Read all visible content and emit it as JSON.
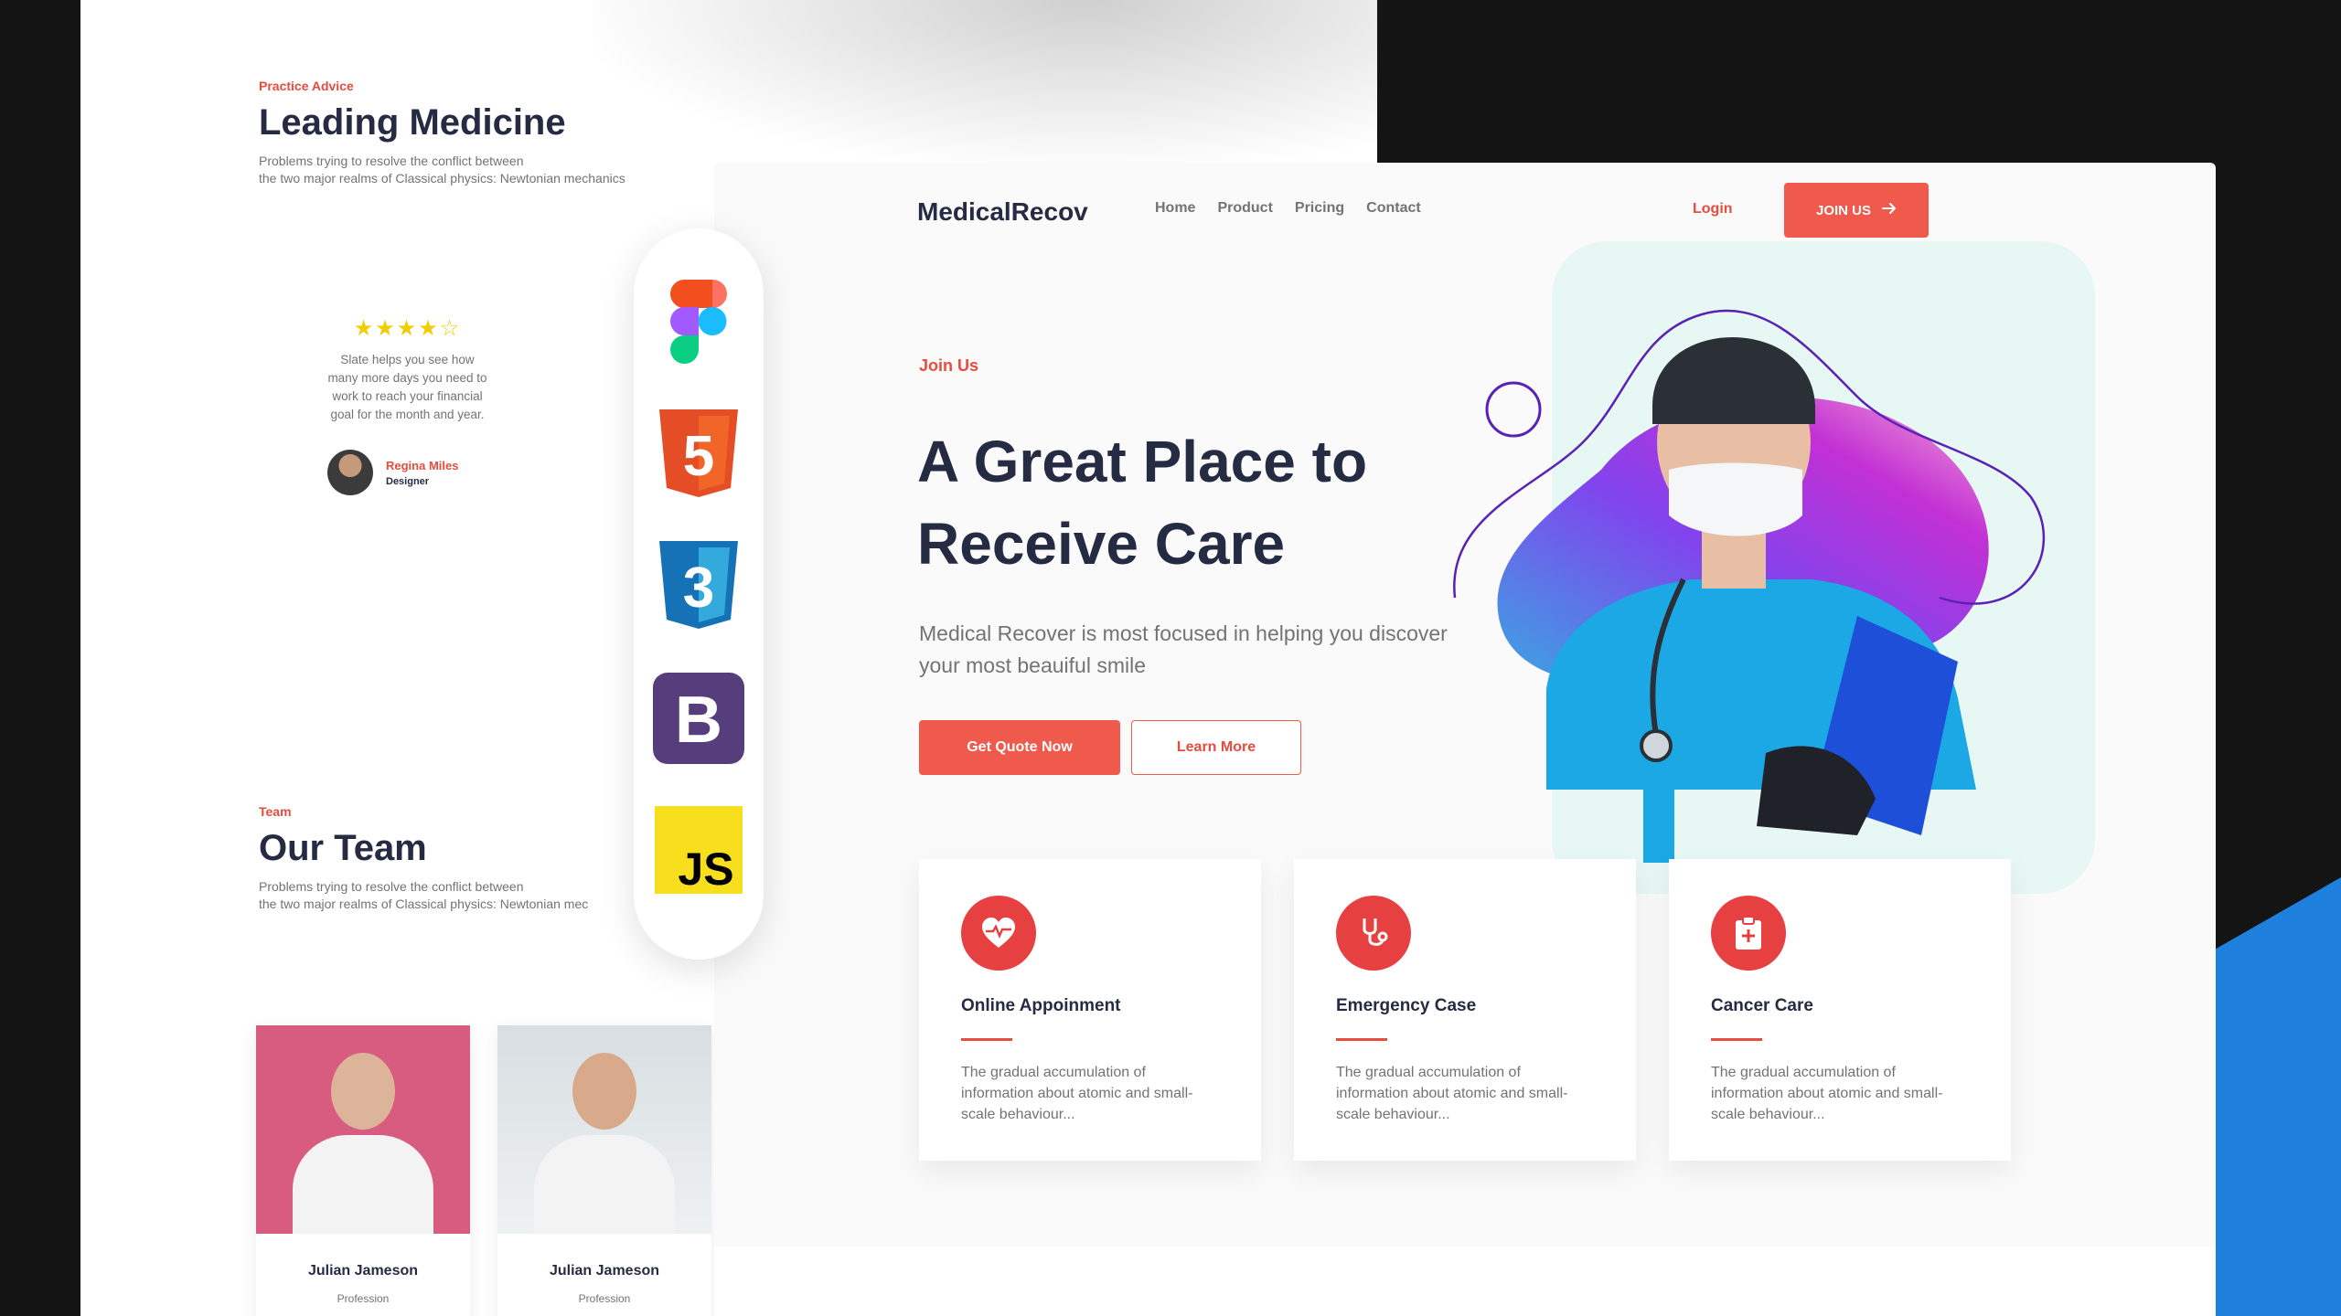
{
  "back_page": {
    "lead": {
      "eyebrow": "Practice Advice",
      "title": "Leading Medicine",
      "desc_line1": "Problems trying to resolve the conflict between",
      "desc_line2": "the two major realms of Classical physics: Newtonian mechanics"
    },
    "testimonial": {
      "rating": 4,
      "rating_max": 5,
      "quote": "Slate helps you see how many more days you need to work to reach your financial goal for the month and year.",
      "author_name": "Regina Miles",
      "author_role": "Designer"
    },
    "team": {
      "eyebrow": "Team",
      "title": "Our Team",
      "desc_line1": "Problems trying to resolve the conflict between",
      "desc_line2": "the two major realms of Classical physics: Newtonian mec",
      "members": [
        {
          "name": "Julian Jameson",
          "role": "Profession"
        },
        {
          "name": "Julian Jameson",
          "role": "Profession"
        }
      ]
    }
  },
  "tech_stack": {
    "icons": [
      "figma-icon",
      "html5-icon",
      "css3-icon",
      "bootstrap-icon",
      "javascript-icon"
    ],
    "html5_text": "5",
    "css3_text": "3",
    "bootstrap_text": "B",
    "js_text": "JS"
  },
  "navbar": {
    "brand": "MedicalRecov",
    "links": [
      "Home",
      "Product",
      "Pricing",
      "Contact"
    ],
    "login": "Login",
    "join": "JOIN US",
    "join_icon": "arrow-right-icon"
  },
  "hero": {
    "eyebrow": "Join Us",
    "title": "A Great Place to Receive Care",
    "desc": "Medical Recover is most focused in helping you discover your most beauiful smile",
    "primary_button": "Get Quote Now",
    "secondary_button": "Learn More"
  },
  "features": [
    {
      "icon": "heart-pulse-icon",
      "title": "Online Appoinment",
      "desc": "The gradual accumulation of information about atomic and small-scale behaviour..."
    },
    {
      "icon": "stethoscope-icon",
      "title": "Emergency Case",
      "desc": "The gradual accumulation of information about atomic and small-scale behaviour..."
    },
    {
      "icon": "clipboard-medical-icon",
      "title": "Cancer Care",
      "desc": "The gradual accumulation of information about atomic and small-scale behaviour..."
    }
  ],
  "colors": {
    "accent": "#E74C3C",
    "heading": "#252B42",
    "muted": "#737373",
    "mint": "#E7F7F4",
    "blue": "#1F7FDC"
  }
}
